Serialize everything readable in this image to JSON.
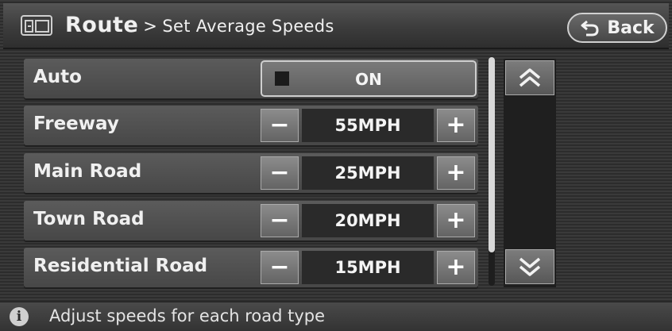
{
  "header": {
    "section": "Route",
    "separator": ">",
    "subtitle": "Set Average Speeds",
    "back_label": "Back"
  },
  "rows": [
    {
      "label": "Auto",
      "type": "toggle",
      "value": "ON",
      "indicator_on": false
    },
    {
      "label": "Freeway",
      "type": "stepper",
      "minus": "−",
      "value": "55MPH",
      "plus": "+"
    },
    {
      "label": "Main Road",
      "type": "stepper",
      "minus": "−",
      "value": "25MPH",
      "plus": "+"
    },
    {
      "label": "Town Road",
      "type": "stepper",
      "minus": "−",
      "value": "20MPH",
      "plus": "+"
    },
    {
      "label": "Residential Road",
      "type": "stepper",
      "minus": "−",
      "value": "15MPH",
      "plus": "+"
    }
  ],
  "footer": {
    "info_glyph": "i",
    "message": "Adjust speeds for each road type"
  },
  "icons": {
    "header_icon": "route-settings-icon",
    "back_icon": "back-arrow-icon",
    "scroll_up_icon": "double-chevron-up-icon",
    "scroll_down_icon": "double-chevron-down-icon",
    "info_icon": "info-icon"
  },
  "colors": {
    "background": "#2c2c2c",
    "row": "#525252",
    "value_field": "#2a2a2a",
    "button": "#7a7a7a",
    "text": "#f0f0f0"
  }
}
